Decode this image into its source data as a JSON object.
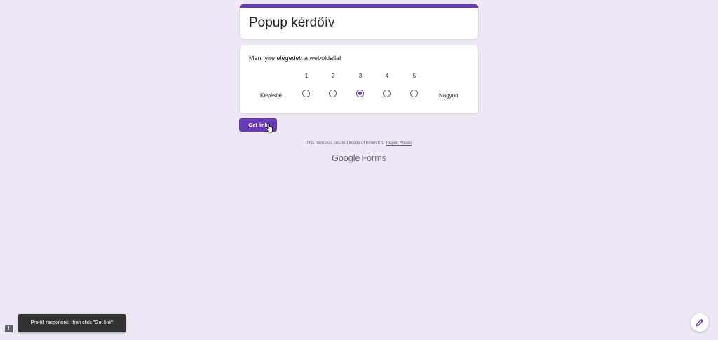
{
  "form": {
    "title": "Popup kérdőív"
  },
  "question": {
    "text": "Mennyire elégedett a weboldallal",
    "scale": [
      "1",
      "2",
      "3",
      "4",
      "5"
    ],
    "low_label": "Kevésbé",
    "high_label": "Nagyon",
    "selected": "3"
  },
  "actions": {
    "get_link_label": "Get link"
  },
  "footer": {
    "created_text": "This form was created inside of Intren Kft.",
    "report_abuse": "Report Abuse",
    "brand_google": "Google",
    "brand_forms": "Forms"
  },
  "snackbar": {
    "message": "Pre-fill responses, then click \"Get link\""
  },
  "icons": {
    "feedback": "feedback-icon",
    "edit": "pencil-icon"
  },
  "colors": {
    "accent": "#673ab7",
    "background": "#ede7f6"
  }
}
